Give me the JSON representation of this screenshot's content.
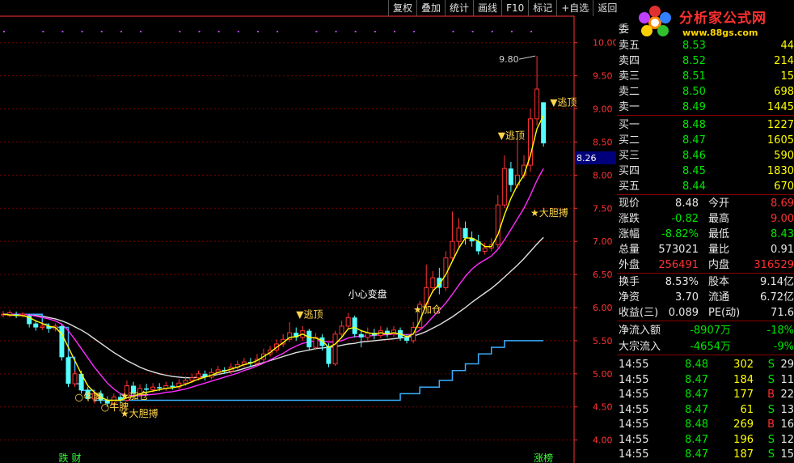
{
  "toolbar": [
    "复权",
    "叠加",
    "统计",
    "画线",
    "F10",
    "标记",
    "+自选",
    "返回"
  ],
  "logo": {
    "brand": "分析家公式网",
    "url": "www.88gs.com"
  },
  "chart_data": {
    "type": "candlestick",
    "ylim": [
      3.8,
      10.4
    ],
    "y_ticks": [
      "10.00",
      "9.50",
      "9.00",
      "8.50",
      "8.00",
      "7.50",
      "7.00",
      "6.50",
      "6.00",
      "5.50",
      "5.00",
      "4.50",
      "4.00"
    ],
    "current_price_label": "8.26",
    "peak_label": "9.80",
    "x_markers": [
      {
        "i": 9,
        "text": "跌"
      },
      {
        "i": 11,
        "text": "财"
      },
      {
        "i": 82,
        "text": "涨榜"
      }
    ],
    "candles": [
      [
        5.9,
        5.9,
        5.95,
        5.85
      ],
      [
        5.88,
        5.92,
        5.96,
        5.85
      ],
      [
        5.9,
        5.88,
        5.94,
        5.84
      ],
      [
        5.88,
        5.9,
        5.93,
        5.85
      ],
      [
        5.88,
        5.75,
        5.9,
        5.7
      ],
      [
        5.76,
        5.7,
        5.8,
        5.65
      ],
      [
        5.7,
        5.72,
        5.78,
        5.66
      ],
      [
        5.72,
        5.68,
        5.76,
        5.62
      ],
      [
        5.68,
        5.72,
        5.76,
        5.64
      ],
      [
        5.72,
        5.25,
        5.74,
        5.2
      ],
      [
        5.25,
        4.85,
        5.28,
        4.8
      ],
      [
        4.85,
        5.0,
        5.05,
        4.8
      ],
      [
        5.0,
        4.75,
        5.05,
        4.7
      ],
      [
        4.76,
        4.62,
        4.8,
        4.6
      ],
      [
        4.62,
        4.7,
        4.74,
        4.55
      ],
      [
        4.7,
        4.6,
        4.75,
        4.55
      ],
      [
        4.6,
        4.55,
        4.66,
        4.5
      ],
      [
        4.55,
        4.65,
        4.7,
        4.5
      ],
      [
        4.65,
        4.6,
        4.7,
        4.55
      ],
      [
        4.6,
        4.82,
        4.9,
        4.58
      ],
      [
        4.82,
        4.7,
        4.88,
        4.62
      ],
      [
        4.7,
        4.78,
        4.84,
        4.66
      ],
      [
        4.78,
        4.76,
        4.85,
        4.7
      ],
      [
        4.76,
        4.8,
        4.86,
        4.72
      ],
      [
        4.8,
        4.78,
        4.86,
        4.74
      ],
      [
        4.78,
        4.82,
        4.88,
        4.74
      ],
      [
        4.82,
        4.8,
        4.88,
        4.76
      ],
      [
        4.8,
        4.86,
        4.92,
        4.76
      ],
      [
        4.86,
        4.9,
        4.96,
        4.82
      ],
      [
        4.9,
        4.94,
        5.0,
        4.86
      ],
      [
        4.94,
        5.0,
        5.05,
        4.9
      ],
      [
        5.0,
        4.95,
        5.05,
        4.9
      ],
      [
        4.95,
        5.02,
        5.08,
        4.92
      ],
      [
        5.02,
        5.06,
        5.12,
        4.98
      ],
      [
        5.06,
        5.04,
        5.1,
        5.0
      ],
      [
        5.04,
        5.1,
        5.16,
        5.0
      ],
      [
        5.1,
        5.14,
        5.2,
        5.06
      ],
      [
        5.14,
        5.18,
        5.24,
        5.1
      ],
      [
        5.18,
        5.16,
        5.24,
        5.1
      ],
      [
        5.16,
        5.22,
        5.3,
        5.12
      ],
      [
        5.22,
        5.3,
        5.38,
        5.18
      ],
      [
        5.3,
        5.36,
        5.42,
        5.26
      ],
      [
        5.36,
        5.45,
        5.52,
        5.32
      ],
      [
        5.45,
        5.52,
        5.6,
        5.4
      ],
      [
        5.52,
        5.62,
        5.78,
        5.48
      ],
      [
        5.62,
        5.55,
        5.7,
        5.5
      ],
      [
        5.55,
        5.65,
        5.72,
        5.5
      ],
      [
        5.65,
        5.4,
        5.68,
        5.35
      ],
      [
        5.4,
        5.55,
        5.62,
        5.36
      ],
      [
        5.55,
        5.42,
        5.6,
        5.35
      ],
      [
        5.42,
        5.15,
        5.46,
        5.1
      ],
      [
        5.15,
        5.6,
        5.65,
        5.12
      ],
      [
        5.6,
        5.72,
        5.8,
        5.55
      ],
      [
        5.72,
        5.85,
        5.92,
        5.68
      ],
      [
        5.85,
        5.6,
        5.88,
        5.55
      ],
      [
        5.6,
        5.55,
        5.66,
        5.4
      ],
      [
        5.55,
        5.62,
        5.7,
        5.5
      ],
      [
        5.62,
        5.58,
        5.68,
        5.52
      ],
      [
        5.58,
        5.65,
        5.72,
        5.54
      ],
      [
        5.65,
        5.6,
        5.7,
        5.55
      ],
      [
        5.6,
        5.66,
        5.72,
        5.56
      ],
      [
        5.66,
        5.55,
        5.7,
        5.5
      ],
      [
        5.55,
        5.5,
        5.6,
        5.46
      ],
      [
        5.5,
        5.7,
        5.78,
        5.46
      ],
      [
        5.7,
        6.05,
        6.1,
        5.66
      ],
      [
        6.05,
        6.3,
        6.65,
        6.0
      ],
      [
        6.3,
        6.45,
        6.55,
        6.22
      ],
      [
        6.45,
        6.3,
        6.6,
        6.2
      ],
      [
        6.3,
        6.75,
        6.85,
        6.25
      ],
      [
        6.75,
        7.0,
        7.45,
        6.7
      ],
      [
        7.0,
        7.2,
        7.35,
        6.9
      ],
      [
        7.2,
        7.05,
        7.3,
        6.95
      ],
      [
        7.05,
        7.0,
        7.15,
        6.92
      ],
      [
        7.0,
        6.85,
        7.1,
        6.8
      ],
      [
        6.85,
        6.9,
        6.98,
        6.8
      ],
      [
        6.9,
        6.95,
        7.05,
        6.85
      ],
      [
        6.95,
        7.55,
        7.7,
        6.9
      ],
      [
        7.55,
        8.1,
        8.3,
        7.5
      ],
      [
        8.1,
        7.85,
        8.2,
        7.75
      ],
      [
        7.85,
        8.0,
        8.6,
        7.8
      ],
      [
        8.0,
        8.15,
        8.3,
        7.95
      ],
      [
        8.15,
        8.85,
        9.0,
        8.05
      ],
      [
        8.85,
        9.3,
        9.8,
        8.75
      ],
      [
        9.1,
        8.48,
        9.1,
        8.43
      ]
    ],
    "ma_short": [
      5.9,
      5.89,
      5.88,
      5.88,
      5.85,
      5.8,
      5.76,
      5.72,
      5.7,
      5.6,
      5.4,
      5.2,
      5.0,
      4.82,
      4.72,
      4.65,
      4.6,
      4.6,
      4.6,
      4.64,
      4.66,
      4.7,
      4.72,
      4.74,
      4.76,
      4.78,
      4.79,
      4.81,
      4.84,
      4.88,
      4.92,
      4.95,
      4.98,
      5.02,
      5.04,
      5.07,
      5.1,
      5.14,
      5.16,
      5.2,
      5.26,
      5.32,
      5.4,
      5.47,
      5.55,
      5.56,
      5.6,
      5.55,
      5.54,
      5.5,
      5.4,
      5.45,
      5.55,
      5.68,
      5.7,
      5.65,
      5.62,
      5.6,
      5.62,
      5.6,
      5.62,
      5.6,
      5.56,
      5.6,
      5.8,
      6.05,
      6.25,
      6.35,
      6.5,
      6.7,
      6.9,
      7.05,
      7.05,
      7.0,
      6.92,
      6.92,
      7.1,
      7.4,
      7.65,
      7.85,
      8.0,
      8.3,
      8.7,
      8.9
    ],
    "ma_mid": [
      5.9,
      5.9,
      5.9,
      5.9,
      5.89,
      5.87,
      5.85,
      5.83,
      5.8,
      5.75,
      5.65,
      5.52,
      5.38,
      5.24,
      5.1,
      4.98,
      4.86,
      4.77,
      4.7,
      4.68,
      4.67,
      4.67,
      4.68,
      4.69,
      4.7,
      4.72,
      4.73,
      4.75,
      4.77,
      4.8,
      4.83,
      4.86,
      4.89,
      4.92,
      4.95,
      4.98,
      5.01,
      5.05,
      5.08,
      5.12,
      5.16,
      5.21,
      5.26,
      5.31,
      5.37,
      5.42,
      5.46,
      5.48,
      5.5,
      5.5,
      5.48,
      5.48,
      5.5,
      5.54,
      5.56,
      5.57,
      5.57,
      5.58,
      5.59,
      5.59,
      5.6,
      5.6,
      5.59,
      5.6,
      5.66,
      5.75,
      5.86,
      5.96,
      6.07,
      6.2,
      6.34,
      6.47,
      6.58,
      6.66,
      6.72,
      6.78,
      6.88,
      7.02,
      7.18,
      7.34,
      7.5,
      7.7,
      7.92,
      8.1
    ],
    "ma_long": [
      5.9,
      5.9,
      5.9,
      5.9,
      5.89,
      5.88,
      5.87,
      5.85,
      5.83,
      5.8,
      5.76,
      5.71,
      5.66,
      5.6,
      5.53,
      5.46,
      5.39,
      5.32,
      5.26,
      5.2,
      5.15,
      5.1,
      5.06,
      5.03,
      5.0,
      4.98,
      4.96,
      4.95,
      4.94,
      4.94,
      4.95,
      4.96,
      4.97,
      4.99,
      5.01,
      5.03,
      5.05,
      5.08,
      5.11,
      5.14,
      5.17,
      5.2,
      5.23,
      5.26,
      5.29,
      5.32,
      5.34,
      5.36,
      5.38,
      5.39,
      5.4,
      5.41,
      5.43,
      5.45,
      5.46,
      5.48,
      5.49,
      5.5,
      5.51,
      5.52,
      5.53,
      5.54,
      5.55,
      5.57,
      5.6,
      5.64,
      5.69,
      5.74,
      5.8,
      5.86,
      5.93,
      6.0,
      6.08,
      6.15,
      6.22,
      6.29,
      6.37,
      6.46,
      6.55,
      6.64,
      6.74,
      6.85,
      6.96,
      7.06
    ],
    "support": [
      5.9,
      5.9,
      5.9,
      5.9,
      5.9,
      5.9,
      5.75,
      5.7,
      5.7,
      5.7,
      5.25,
      4.85,
      4.75,
      4.75,
      4.6,
      4.6,
      4.6,
      4.6,
      4.6,
      4.6,
      4.6,
      4.6,
      4.6,
      4.6,
      4.6,
      4.6,
      4.6,
      4.6,
      4.6,
      4.6,
      4.6,
      4.6,
      4.6,
      4.6,
      4.6,
      4.6,
      4.6,
      4.6,
      4.6,
      4.6,
      4.6,
      4.6,
      4.6,
      4.6,
      4.6,
      4.6,
      4.6,
      4.6,
      4.6,
      4.6,
      4.6,
      4.6,
      4.6,
      4.6,
      4.6,
      4.6,
      4.6,
      4.6,
      4.6,
      4.6,
      4.6,
      4.7,
      4.7,
      4.7,
      4.8,
      4.8,
      4.8,
      4.9,
      4.9,
      5.05,
      5.05,
      5.15,
      5.15,
      5.3,
      5.3,
      5.4,
      5.4,
      5.5,
      5.5,
      5.5,
      5.5,
      5.5,
      5.5,
      5.5
    ],
    "annotations": [
      {
        "i": 11,
        "price": 4.6,
        "text": "○牛脾",
        "color": "#ffd54a"
      },
      {
        "i": 15,
        "price": 4.45,
        "text": "○牛脾",
        "color": "#ffd54a"
      },
      {
        "i": 18,
        "price": 4.62,
        "text": "★加仓",
        "color": "#ffd54a"
      },
      {
        "i": 18,
        "price": 4.35,
        "text": "★大胆搏",
        "color": "#ffd54a"
      },
      {
        "i": 45,
        "price": 5.85,
        "text": "▼逃顶",
        "color": "#ffd54a"
      },
      {
        "i": 53,
        "price": 6.15,
        "text": "小心变盘",
        "color": "#ffffff"
      },
      {
        "i": 63,
        "price": 5.92,
        "text": "★加仓",
        "color": "#ffd54a"
      },
      {
        "i": 76,
        "price": 8.55,
        "text": "▼逃顶",
        "color": "#ffd54a"
      },
      {
        "i": 84,
        "price": 9.05,
        "text": "▼逃顶",
        "color": "#ffd54a"
      },
      {
        "i": 81,
        "price": 7.38,
        "text": "★大胆搏",
        "color": "#ffd54a"
      }
    ]
  },
  "quotes": [
    {
      "label": "委",
      "value": "",
      "vol": ""
    },
    {
      "label": "卖五",
      "value": "8.53",
      "vol": "44"
    },
    {
      "label": "卖四",
      "value": "8.52",
      "vol": "214"
    },
    {
      "label": "卖三",
      "value": "8.51",
      "vol": "15"
    },
    {
      "label": "卖二",
      "value": "8.50",
      "vol": "698"
    },
    {
      "label": "卖一",
      "value": "8.49",
      "vol": "1445"
    },
    {
      "label": "买一",
      "value": "8.48",
      "vol": "1227"
    },
    {
      "label": "买二",
      "value": "8.47",
      "vol": "1605"
    },
    {
      "label": "买三",
      "value": "8.46",
      "vol": "590"
    },
    {
      "label": "买四",
      "value": "8.45",
      "vol": "1830"
    },
    {
      "label": "买五",
      "value": "8.44",
      "vol": "670"
    }
  ],
  "stats": [
    {
      "l1": "现价",
      "v1": "8.48",
      "l2": "今开",
      "v2": "8.69"
    },
    {
      "l1": "涨跌",
      "v1": "-0.82",
      "l2": "最高",
      "v2": "9.00"
    },
    {
      "l1": "涨幅",
      "v1": "-8.82%",
      "l2": "最低",
      "v2": "8.43"
    },
    {
      "l1": "总量",
      "v1": "573021",
      "l2": "量比",
      "v2": "0.91"
    },
    {
      "l1": "外盘",
      "v1": "256491",
      "l2": "内盘",
      "v2": "316529"
    },
    {
      "l1": "换手",
      "v1": "8.53%",
      "l2": "股本",
      "v2": "9.14亿"
    },
    {
      "l1": "净资",
      "v1": "3.70",
      "l2": "流通",
      "v2": "6.72亿"
    },
    {
      "l1": "收益(三)",
      "v1": "0.089",
      "l2": "PE(动)",
      "v2": "71.6"
    },
    {
      "l1": "净流入额",
      "v1": "-8907万",
      "l2": "",
      "v2": "-18%"
    },
    {
      "l1": "大宗流入",
      "v1": "-4654万",
      "l2": "",
      "v2": "-9%"
    }
  ],
  "ticks": [
    {
      "t": "14:55",
      "p": "8.48",
      "v": "302",
      "s": "S",
      "n": "29"
    },
    {
      "t": "14:55",
      "p": "8.47",
      "v": "184",
      "s": "S",
      "n": "11"
    },
    {
      "t": "14:55",
      "p": "8.47",
      "v": "177",
      "s": "B",
      "n": "22"
    },
    {
      "t": "14:55",
      "p": "8.47",
      "v": "61",
      "s": "S",
      "n": "13"
    },
    {
      "t": "14:55",
      "p": "8.48",
      "v": "269",
      "s": "B",
      "n": "16"
    },
    {
      "t": "14:55",
      "p": "8.47",
      "v": "196",
      "s": "S",
      "n": "12"
    },
    {
      "t": "14:55",
      "p": "8.47",
      "v": "187",
      "s": "S",
      "n": "15"
    }
  ],
  "colors": {
    "up": "#ff3232",
    "down": "#54ffff",
    "ma_short": "#ffff00",
    "ma_mid": "#ff2cff",
    "ma_long": "#e0e0e0",
    "support": "#3aaeff",
    "grid": "#7a0000",
    "axis": "#ff3232",
    "sell_label": "#e8e8e8",
    "value_green": "#00e600",
    "value_red": "#ff3030",
    "value_yellow": "#ffff00"
  }
}
